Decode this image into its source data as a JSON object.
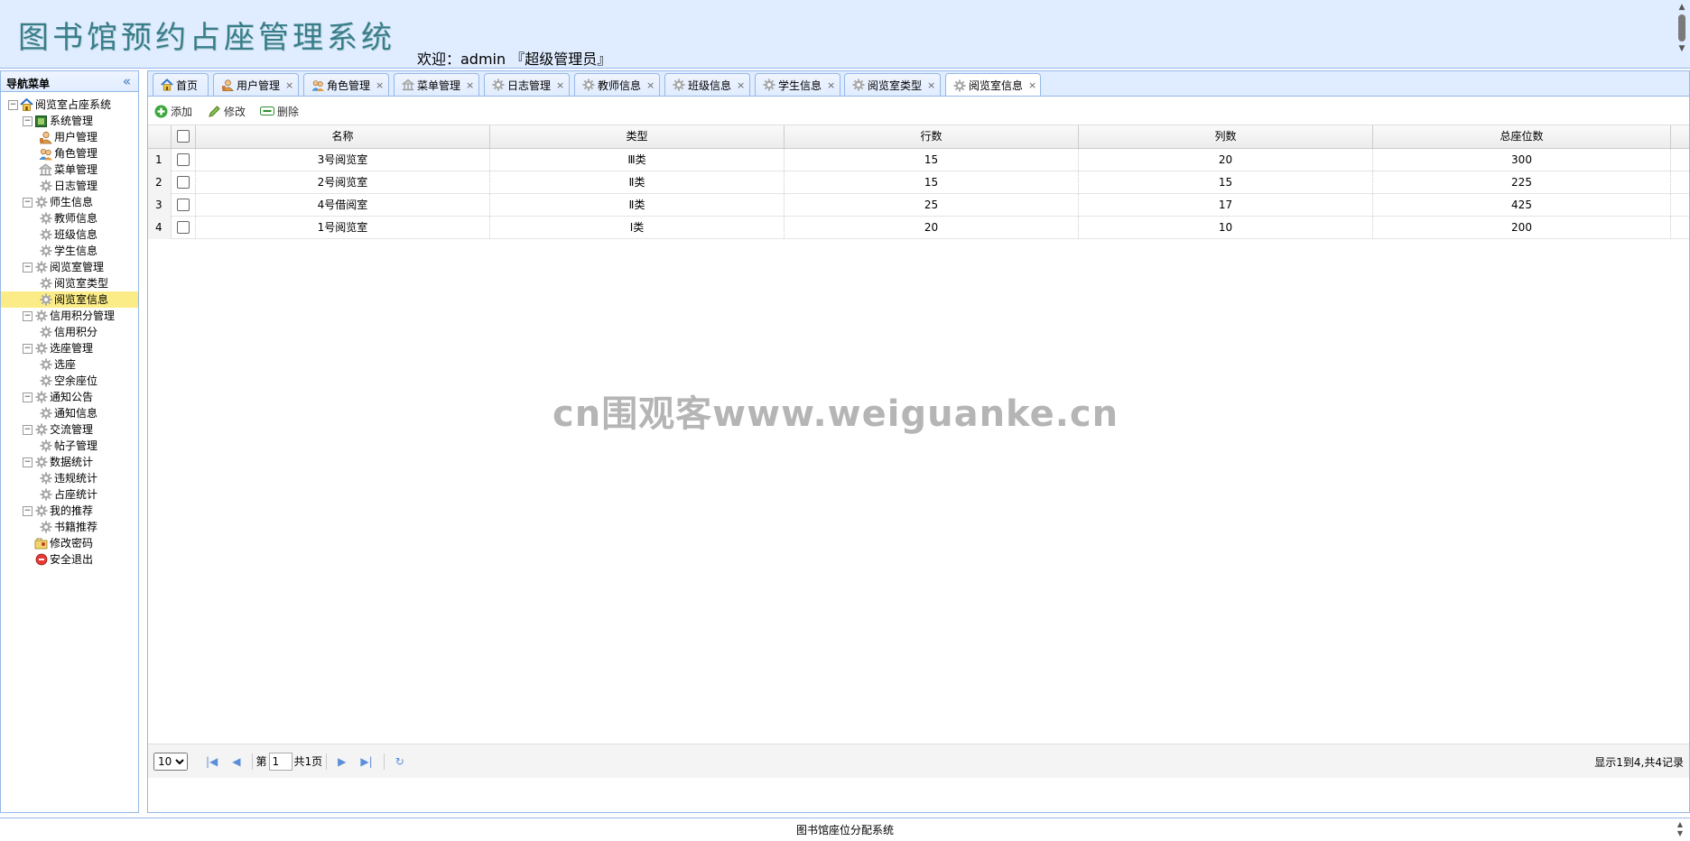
{
  "header": {
    "title": "图书馆预约占座管理系统",
    "welcome": "欢迎：admin 『超级管理员』"
  },
  "sidebar": {
    "title": "导航菜单",
    "collapse": "«",
    "tree": [
      {
        "label": "阅览室占座系统",
        "level": 0,
        "toggle": "−",
        "icon": "home-icon"
      },
      {
        "label": "系统管理",
        "level": 1,
        "toggle": "−",
        "icon": "system-icon"
      },
      {
        "label": "用户管理",
        "level": 2,
        "icon": "user-icon"
      },
      {
        "label": "角色管理",
        "level": 2,
        "icon": "role-icon"
      },
      {
        "label": "菜单管理",
        "level": 2,
        "icon": "menu-icon"
      },
      {
        "label": "日志管理",
        "level": 2,
        "icon": "gear-icon"
      },
      {
        "label": "师生信息",
        "level": 1,
        "toggle": "−",
        "icon": "gear-icon"
      },
      {
        "label": "教师信息",
        "level": 2,
        "icon": "gear-icon"
      },
      {
        "label": "班级信息",
        "level": 2,
        "icon": "gear-icon"
      },
      {
        "label": "学生信息",
        "level": 2,
        "icon": "gear-icon"
      },
      {
        "label": "阅览室管理",
        "level": 1,
        "toggle": "−",
        "icon": "gear-icon"
      },
      {
        "label": "阅览室类型",
        "level": 2,
        "icon": "gear-icon"
      },
      {
        "label": "阅览室信息",
        "level": 2,
        "icon": "gear-icon",
        "selected": true
      },
      {
        "label": "信用积分管理",
        "level": 1,
        "toggle": "−",
        "icon": "gear-icon"
      },
      {
        "label": "信用积分",
        "level": 2,
        "icon": "gear-icon"
      },
      {
        "label": "选座管理",
        "level": 1,
        "toggle": "−",
        "icon": "gear-icon"
      },
      {
        "label": "选座",
        "level": 2,
        "icon": "gear-icon"
      },
      {
        "label": "空余座位",
        "level": 2,
        "icon": "gear-icon"
      },
      {
        "label": "通知公告",
        "level": 1,
        "toggle": "−",
        "icon": "gear-icon"
      },
      {
        "label": "通知信息",
        "level": 2,
        "icon": "gear-icon"
      },
      {
        "label": "交流管理",
        "level": 1,
        "toggle": "−",
        "icon": "gear-icon"
      },
      {
        "label": "帖子管理",
        "level": 2,
        "icon": "gear-icon"
      },
      {
        "label": "数据统计",
        "level": 1,
        "toggle": "−",
        "icon": "gear-icon"
      },
      {
        "label": "违规统计",
        "level": 2,
        "icon": "gear-icon"
      },
      {
        "label": "占座统计",
        "level": 2,
        "icon": "gear-icon"
      },
      {
        "label": "我的推荐",
        "level": 1,
        "toggle": "−",
        "icon": "gear-icon"
      },
      {
        "label": "书籍推荐",
        "level": 2,
        "icon": "gear-icon"
      },
      {
        "label": "修改密码",
        "level": 1,
        "icon": "key-icon"
      },
      {
        "label": "安全退出",
        "level": 1,
        "icon": "exit-icon"
      }
    ]
  },
  "tabs": [
    {
      "label": "首页",
      "icon": "home-icon",
      "closable": false
    },
    {
      "label": "用户管理",
      "icon": "user-icon",
      "closable": true
    },
    {
      "label": "角色管理",
      "icon": "role-icon",
      "closable": true
    },
    {
      "label": "菜单管理",
      "icon": "menu-icon",
      "closable": true
    },
    {
      "label": "日志管理",
      "icon": "gear-icon",
      "closable": true
    },
    {
      "label": "教师信息",
      "icon": "gear-icon",
      "closable": true
    },
    {
      "label": "班级信息",
      "icon": "gear-icon",
      "closable": true
    },
    {
      "label": "学生信息",
      "icon": "gear-icon",
      "closable": true
    },
    {
      "label": "阅览室类型",
      "icon": "gear-icon",
      "closable": true
    },
    {
      "label": "阅览室信息",
      "icon": "gear-icon",
      "closable": true,
      "active": true
    }
  ],
  "tab_close": "×",
  "toolbar": {
    "add_label": "添加",
    "edit_label": "修改",
    "delete_label": "删除"
  },
  "grid": {
    "columns": [
      "名称",
      "类型",
      "行数",
      "列数",
      "总座位数"
    ],
    "rows": [
      {
        "num": "1",
        "cells": [
          "3号阅览室",
          "Ⅲ类",
          "15",
          "20",
          "300"
        ]
      },
      {
        "num": "2",
        "cells": [
          "2号阅览室",
          "Ⅱ类",
          "15",
          "15",
          "225"
        ]
      },
      {
        "num": "3",
        "cells": [
          "4号借阅室",
          "Ⅱ类",
          "25",
          "17",
          "425"
        ]
      },
      {
        "num": "4",
        "cells": [
          "1号阅览室",
          "Ⅰ类",
          "20",
          "10",
          "200"
        ]
      }
    ]
  },
  "pager": {
    "page_size": "10",
    "page_prefix": "第",
    "page_value": "1",
    "page_suffix": "共1页",
    "info": "显示1到4,共4记录"
  },
  "footer": {
    "text": "图书馆座位分配系统"
  },
  "watermark": "cn围观客www.weiguanke.cn",
  "colors": {
    "header_bg": "#e0ecff",
    "border": "#95b8e7",
    "selected_bg": "#fbec88",
    "title_color": "#3a7d8a"
  }
}
